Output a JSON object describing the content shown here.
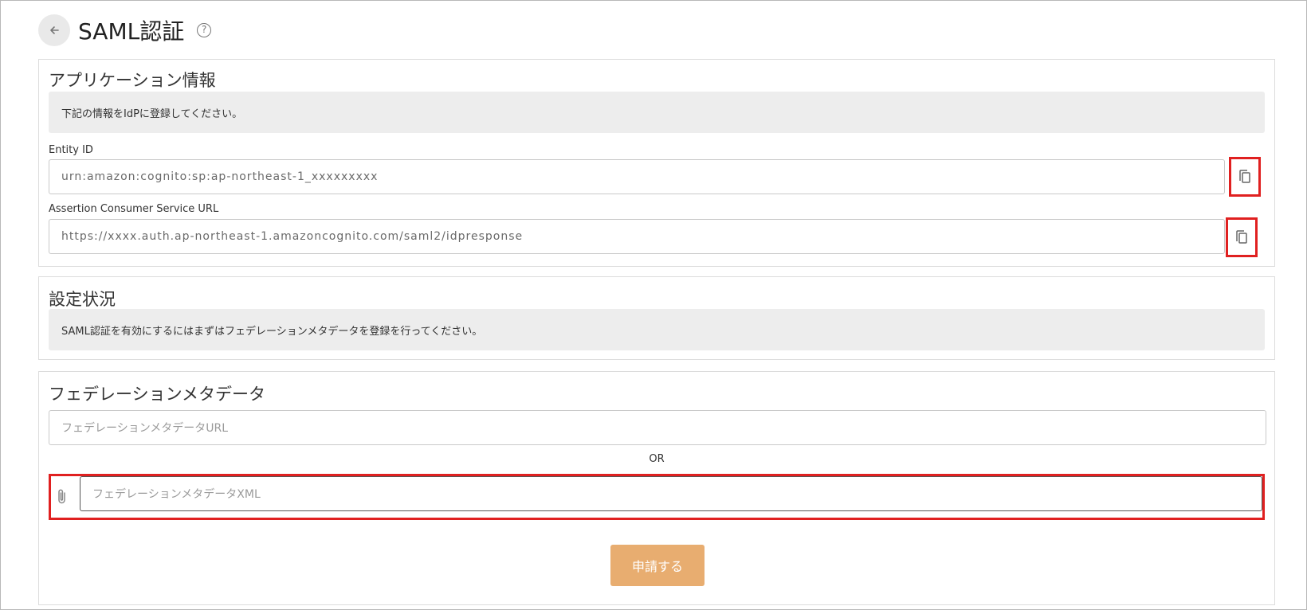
{
  "header": {
    "title": "SAML認証",
    "back_icon": "arrow-left-icon",
    "help_icon": "question-circle-icon",
    "help_glyph": "?"
  },
  "application_info": {
    "title": "アプリケーション情報",
    "notice": "下記の情報をIdPに登録してください。",
    "entity_id": {
      "label": "Entity ID",
      "value": "urn:amazon:cognito:sp:ap-northeast-1_xxxxxxxxx"
    },
    "acs_url": {
      "label": "Assertion Consumer Service URL",
      "value": "https://xxxx.auth.ap-northeast-1.amazoncognito.com/saml2/idpresponse"
    },
    "copy_icon": "copy-icon"
  },
  "status": {
    "title": "設定状況",
    "notice": "SAML認証を有効にするにはまずはフェデレーションメタデータを登録を行ってください。"
  },
  "federation": {
    "title": "フェデレーションメタデータ",
    "url_placeholder": "フェデレーションメタデータURL",
    "or_label": "OR",
    "xml_placeholder": "フェデレーションメタデータXML",
    "attach_icon": "paperclip-icon",
    "submit_label": "申請する"
  },
  "colors": {
    "highlight": "#e02020",
    "submit_bg": "#e8ad70",
    "notice_bg": "#ededed"
  }
}
